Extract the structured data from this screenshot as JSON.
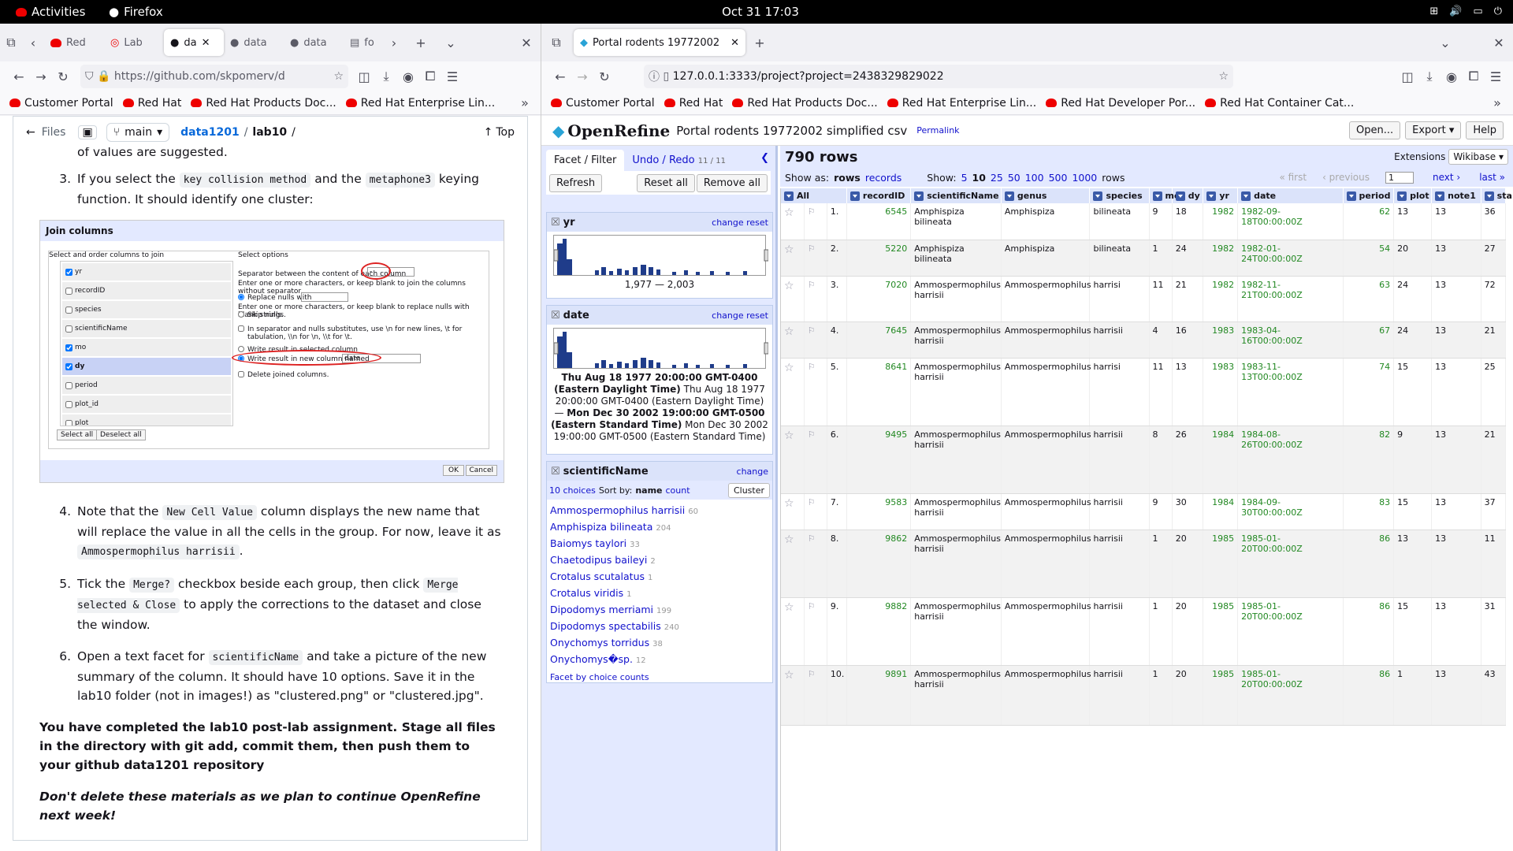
{
  "system": {
    "activities": "Activities",
    "app": "Firefox",
    "clock": "Oct 31  17:03"
  },
  "left": {
    "tabs": [
      "Red",
      "Lab",
      "da",
      "data",
      "data",
      "fo"
    ],
    "url": "https://github.com/skpomerv/d",
    "bookmarks": [
      "Customer Portal",
      "Red Hat",
      "Red Hat Products Doc...",
      "Red Hat Enterprise Lin..."
    ],
    "gh": {
      "files": "Files",
      "branch": "main",
      "repo": "data1201",
      "sep": "/",
      "folder": "lab10",
      "slash": "/",
      "top": "Top"
    },
    "partial": "of values are suggested.",
    "item3": {
      "n": "3.",
      "a": "If you select the",
      "code1": "key collision method",
      "b": "and the",
      "code2": "metaphone3",
      "c": "keying function. It should identify one cluster:"
    },
    "dialog": {
      "title": "Join columns",
      "col_title": "Select and order columns to join",
      "opt_title": "Select options",
      "cols": [
        {
          "n": "yr",
          "c": true
        },
        {
          "n": "recordID",
          "c": false
        },
        {
          "n": "species",
          "c": false
        },
        {
          "n": "scientificName",
          "c": false
        },
        {
          "n": "mo",
          "c": true
        },
        {
          "n": "dy",
          "c": true
        },
        {
          "n": "period",
          "c": false
        },
        {
          "n": "plot_id",
          "c": false
        },
        {
          "n": "plot",
          "c": false
        }
      ],
      "sep_label": "Separator between the content of each column",
      "sep_val": "-",
      "sep_hint": "Enter one or more characters, or keep blank to join the columns without separator.",
      "replace": "Replace nulls with",
      "replace_hint": "Enter one or more characters, or keep blank to replace nulls with blank strings.",
      "skip": "Skip nulls.",
      "escape": "In separator and nulls substitutes, use \\n for new lines, \\t for tabulation, \\\\n for \\n, \\\\t for \\t.",
      "write_sel": "Write result in selected column",
      "write_new": "Write result in new column named",
      "new_name": "date",
      "delete": "Delete joined columns.",
      "select_all": "Select all",
      "deselect_all": "Deselect all",
      "ok": "OK",
      "cancel": "Cancel"
    },
    "item4": {
      "n": "4.",
      "a": "Note that the",
      "code1": "New Cell Value",
      "b": "column displays the new name that will replace the value in all the cells in the group. For now, leave it as",
      "code2": "Ammospermophilus harrisii",
      "c": "."
    },
    "item5": {
      "n": "5.",
      "a": "Tick the",
      "code1": "Merge?",
      "b": "checkbox beside each group, then click",
      "code2": "Merge selected & Close",
      "c": "to apply the corrections to the dataset and close the window."
    },
    "item6": {
      "n": "6.",
      "a": "Open a text facet for",
      "code1": "scientificName",
      "b": "and take a picture of the new summary of the column. It should have 10 options. Save it in the lab10 folder (not in images!) as \"clustered.png\" or \"clustered.jpg\"."
    },
    "done": "You have completed the lab10 post-lab assignment. Stage all files in the directory with git add, commit them, then push them to your github data1201 repository",
    "dont": "Don't delete these materials as we plan to continue OpenRefine next week!"
  },
  "right": {
    "tab": "Portal rodents 19772002",
    "url": "127.0.0.1:3333/project?project=2438329829022",
    "bookmarks": [
      "Customer Portal",
      "Red Hat",
      "Red Hat Products Doc...",
      "Red Hat Enterprise Lin...",
      "Red Hat Developer Por...",
      "Red Hat Container Cat..."
    ],
    "or": {
      "logo": "OpenRefine",
      "project": "Portal rodents 19772002 simplified csv",
      "permalink": "Permalink",
      "open": "Open...",
      "export": "Export",
      "help": "Help",
      "facet_tab": "Facet / Filter",
      "undo_tab": "Undo / Redo",
      "undo_count": "11 / 11",
      "refresh": "Refresh",
      "reset_all": "Reset all",
      "remove_all": "Remove all",
      "change": "change",
      "reset": "reset",
      "f_yr": "yr",
      "f_yr_range": "1,977 — 2,003",
      "f_date": "date",
      "date_a": "Thu Aug 18 1977 20:00:00 GMT-0400 (Eastern Daylight Time)",
      "date_b": "Thu Aug 18 1977 20:00:00 GMT-0400 (Eastern Daylight Time)",
      "date_dash": "—",
      "date_c": "Mon Dec 30 2002 19:00:00 GMT-0500 (Eastern Standard Time)",
      "date_d": "Mon Dec 30 2002 19:00:00 GMT-0500 (Eastern Standard Time)",
      "f_sci": "scientificName",
      "choices": "10 choices",
      "sortby": "Sort by:",
      "sort_name": "name",
      "sort_count": "count",
      "cluster": "Cluster",
      "sci_list": [
        {
          "n": "Ammospermophilus harrisii",
          "c": "60"
        },
        {
          "n": "Amphispiza bilineata",
          "c": "204"
        },
        {
          "n": "Baiomys taylori",
          "c": "33"
        },
        {
          "n": "Chaetodipus baileyi",
          "c": "2"
        },
        {
          "n": "Crotalus scutalatus",
          "c": "1"
        },
        {
          "n": "Crotalus viridis",
          "c": "1"
        },
        {
          "n": "Dipodomys merriami",
          "c": "199"
        },
        {
          "n": "Dipodomys spectabilis",
          "c": "240"
        },
        {
          "n": "Onychomys torridus",
          "c": "38"
        },
        {
          "n": "Onychomys�sp.",
          "c": "12"
        }
      ],
      "facet_by": "Facet by choice counts",
      "rows": "790 rows",
      "extensions": "Extensions",
      "wikibase": "Wikibase",
      "showas": "Show as:",
      "rows_l": "rows",
      "records": "records",
      "show": "Show:",
      "sizes": [
        "5",
        "10",
        "25",
        "50",
        "100",
        "500",
        "1000"
      ],
      "rows2": "rows",
      "first": "« first",
      "prev": "‹ previous",
      "page": "1",
      "next": "next ›",
      "last": "last »",
      "cols": [
        "All",
        "recordID",
        "scientificName",
        "genus",
        "species",
        "mo",
        "dy",
        "yr",
        "date",
        "period",
        "plot",
        "note1",
        "sta"
      ],
      "data": [
        [
          "1.",
          "6545",
          "Amphispiza bilineata",
          "Amphispiza",
          "bilineata",
          "9",
          "18",
          "1982",
          "1982-09-18T00:00:00Z",
          "62",
          "13",
          "13",
          "36"
        ],
        [
          "2.",
          "5220",
          "Amphispiza bilineata",
          "Amphispiza",
          "bilineata",
          "1",
          "24",
          "1982",
          "1982-01-24T00:00:00Z",
          "54",
          "20",
          "13",
          "27"
        ],
        [
          "3.",
          "7020",
          "Ammospermophilus harrisii",
          "Ammospermophilus",
          "harrisi",
          "11",
          "21",
          "1982",
          "1982-11-21T00:00:00Z",
          "63",
          "24",
          "13",
          "72"
        ],
        [
          "4.",
          "7645",
          "Ammospermophilus harrisii",
          "Ammospermophilus",
          "harrisii",
          "4",
          "16",
          "1983",
          "1983-04-16T00:00:00Z",
          "67",
          "24",
          "13",
          "21"
        ],
        [
          "5.",
          "8641",
          "Ammospermophilus harrisii",
          "Ammospermophilus",
          "harrisi",
          "11",
          "13",
          "1983",
          "1983-11-13T00:00:00Z",
          "74",
          "15",
          "13",
          "25"
        ],
        [
          "6.",
          "9495",
          "Ammospermophilus harrisii",
          "Ammospermophilus",
          "harrisii",
          "8",
          "26",
          "1984",
          "1984-08-26T00:00:00Z",
          "82",
          "9",
          "13",
          "21"
        ],
        [
          "7.",
          "9583",
          "Ammospermophilus harrisii",
          "Ammospermophilus",
          "harrisii",
          "9",
          "30",
          "1984",
          "1984-09-30T00:00:00Z",
          "83",
          "15",
          "13",
          "37"
        ],
        [
          "8.",
          "9862",
          "Ammospermophilus harrisii",
          "Ammospermophilus",
          "harrisii",
          "1",
          "20",
          "1985",
          "1985-01-20T00:00:00Z",
          "86",
          "13",
          "13",
          "11"
        ],
        [
          "9.",
          "9882",
          "Ammospermophilus harrisii",
          "Ammospermophilus",
          "harrisii",
          "1",
          "20",
          "1985",
          "1985-01-20T00:00:00Z",
          "86",
          "15",
          "13",
          "31"
        ],
        [
          "10.",
          "9891",
          "Ammospermophilus harrisii",
          "Ammospermophilus",
          "harrisii",
          "1",
          "20",
          "1985",
          "1985-01-20T00:00:00Z",
          "86",
          "1",
          "13",
          "43"
        ]
      ]
    }
  },
  "colors": {
    "accent": "#11c",
    "or_bg": "#e3e9ff",
    "header": "#dbe3fa",
    "bar": "#1f3c8a",
    "green": "#282"
  }
}
